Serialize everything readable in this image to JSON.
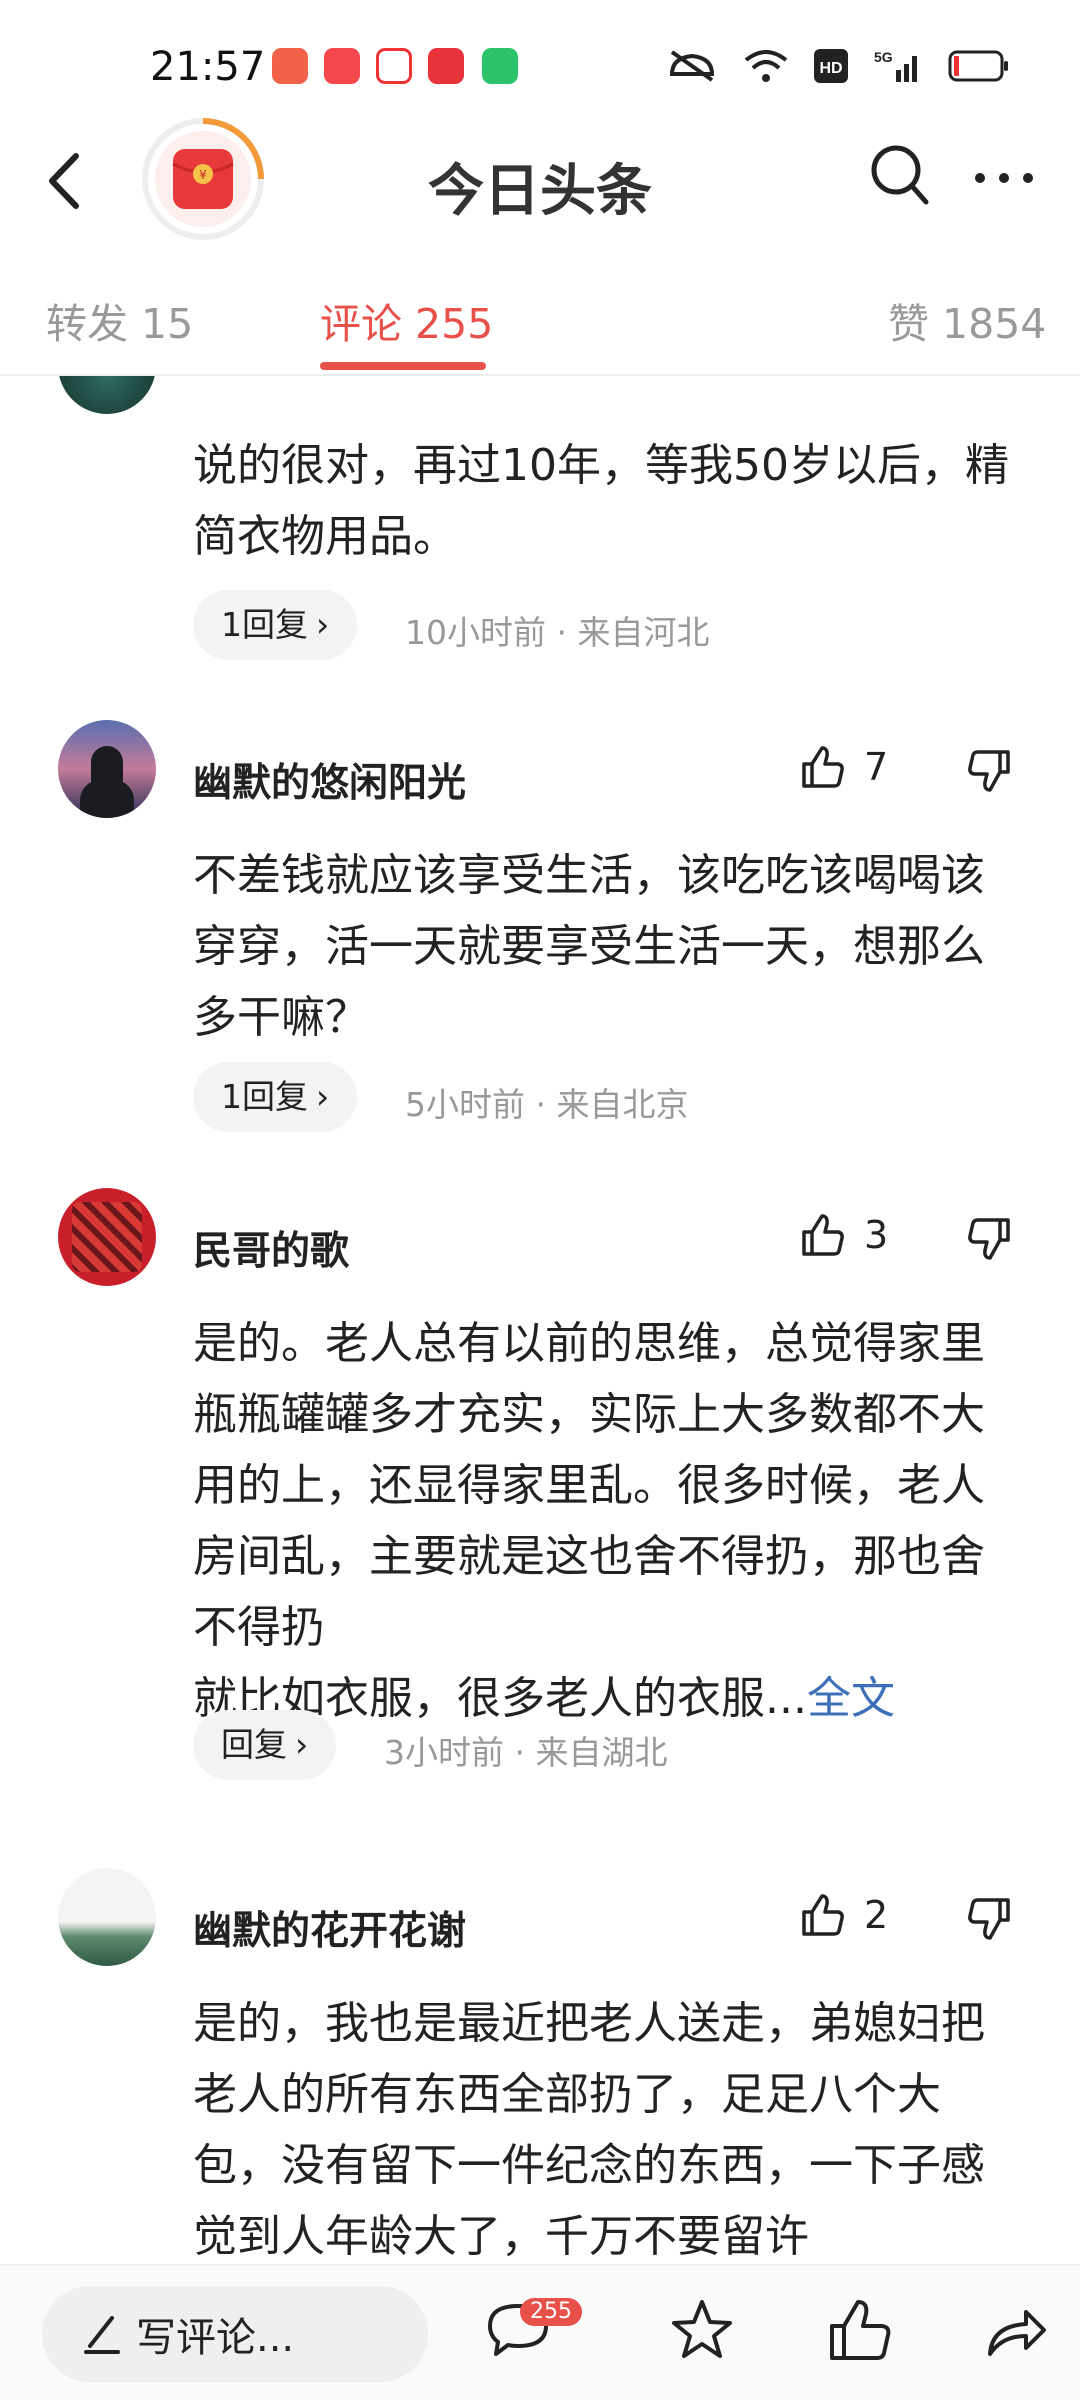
{
  "status": {
    "time": "21:57"
  },
  "header": {
    "title": "今日头条"
  },
  "tabs": [
    {
      "label": "转发 15"
    },
    {
      "label": "评论 255"
    },
    {
      "label": "赞 1854"
    }
  ],
  "comments": [
    {
      "name": "",
      "likes": "",
      "text": "说的很对，再过10年，等我50岁以后，精简衣物用品。",
      "more": "",
      "reply": "1回复",
      "meta": "10小时前 · 来自河北"
    },
    {
      "name": "幽默的悠闲阳光",
      "likes": "7",
      "text": "不差钱就应该享受生活，该吃吃该喝喝该穿穿，活一天就要享受生活一天，想那么多干嘛？",
      "more": "",
      "reply": "1回复",
      "meta": "5小时前 · 来自北京"
    },
    {
      "name": "民哥的歌",
      "likes": "3",
      "text": "是的。老人总有以前的思维，总觉得家里瓶瓶罐罐多才充实，实际上大多数都不大用的上，还显得家里乱。很多时候，老人房间乱，主要就是这也舍不得扔，那也舍不得扔\n就比如衣服，很多老人的衣服...",
      "more": "全文",
      "reply": "回复",
      "meta": "3小时前 · 来自湖北"
    },
    {
      "name": "幽默的花开花谢",
      "likes": "2",
      "text": "是的，我也是最近把老人送走，弟媳妇把老人的所有东西全部扔了，足足八个大包，没有留下一件纪念的东西，一下子感觉到人年龄大了，千万不要留许",
      "more": "",
      "reply": "",
      "meta": ""
    }
  ],
  "bottom": {
    "write_placeholder": "写评论...",
    "comment_count": "255"
  },
  "colors": {
    "accent": "#e8504a",
    "link": "#3d6fb8"
  },
  "icons": [
    "back-icon",
    "red-packet-icon",
    "search-icon",
    "more-icon",
    "thumb-up-icon",
    "thumb-down-icon",
    "pencil-icon",
    "comment-icon",
    "star-icon",
    "share-icon"
  ]
}
